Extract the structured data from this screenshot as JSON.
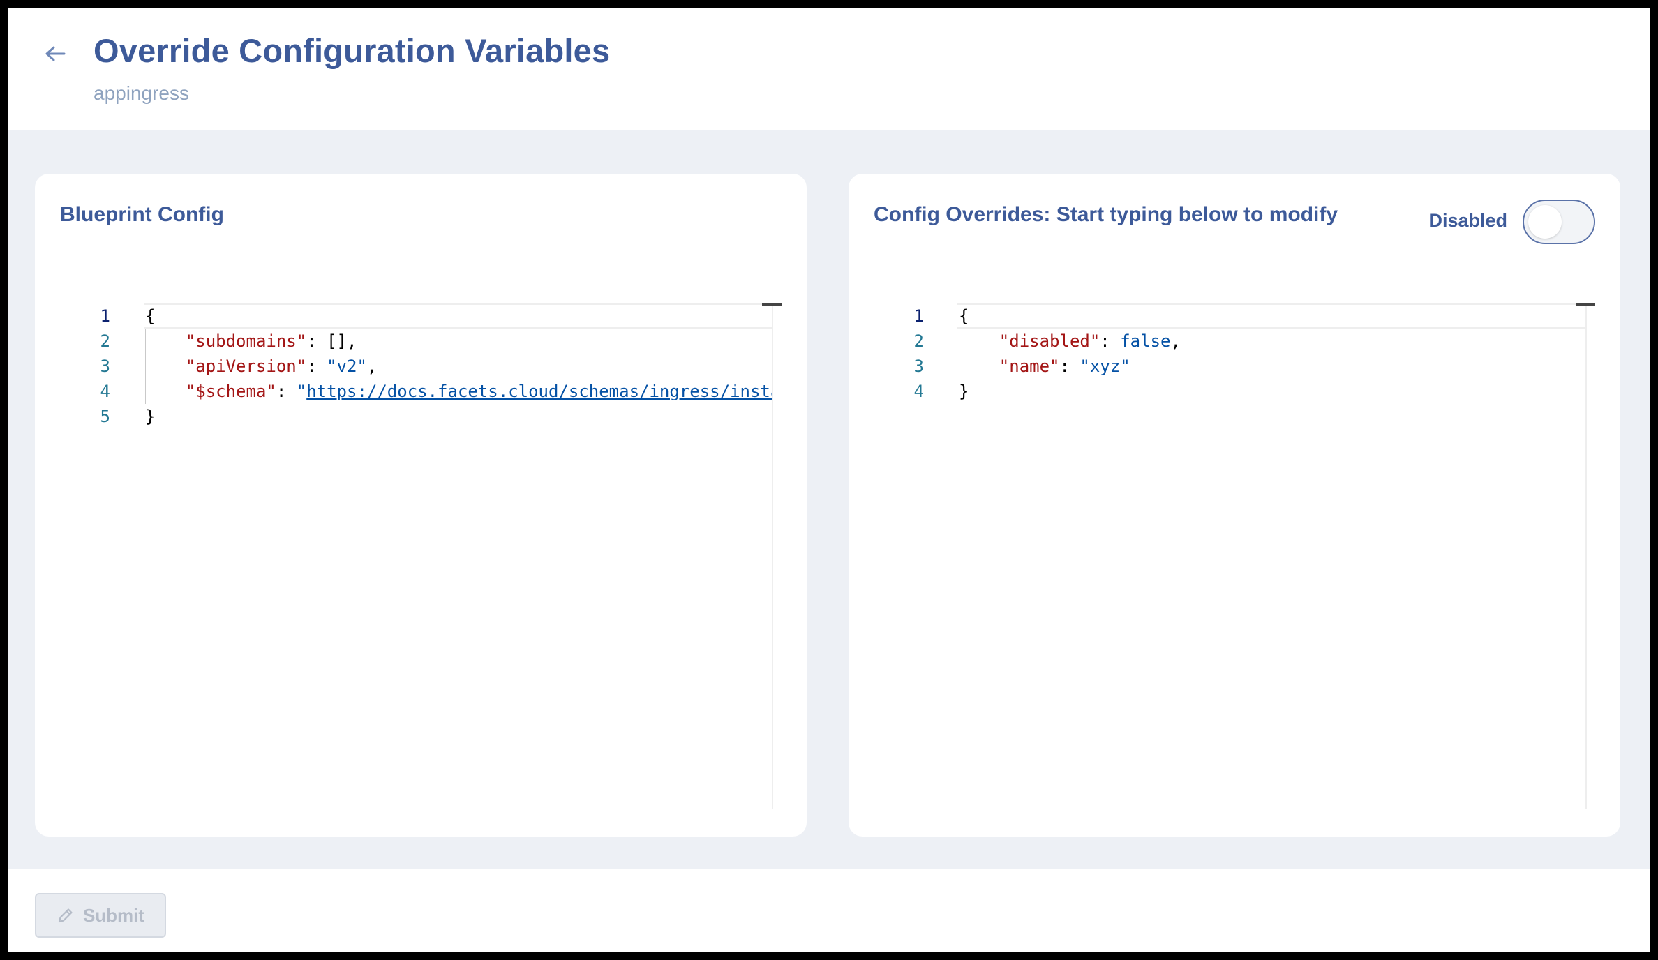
{
  "header": {
    "back_icon": "arrow-left-icon",
    "title": "Override Configuration Variables",
    "subtitle": "appingress"
  },
  "blueprint": {
    "title": "Blueprint Config",
    "line_numbers": [
      "1",
      "2",
      "3",
      "4",
      "5"
    ],
    "lines": [
      {
        "open": "{"
      },
      {
        "key": "\"subdomains\"",
        "sep": ": ",
        "value": "[]",
        "trail": ","
      },
      {
        "key": "\"apiVersion\"",
        "sep": ": ",
        "str": "\"v2\"",
        "trail": ","
      },
      {
        "key": "\"$schema\"",
        "sep": ": ",
        "quote": "\"",
        "link": "https://docs.facets.cloud/schemas/ingress/instance.schema.json"
      },
      {
        "close": "}"
      }
    ]
  },
  "overrides": {
    "title": "Config Overrides: Start typing below to modify",
    "toggle_label": "Disabled",
    "toggle_on": false,
    "line_numbers": [
      "1",
      "2",
      "3",
      "4"
    ],
    "lines": [
      {
        "open": "{"
      },
      {
        "key": "\"disabled\"",
        "sep": ": ",
        "bool": "false",
        "trail": ","
      },
      {
        "key": "\"name\"",
        "sep": ": ",
        "str": "\"xyz\""
      },
      {
        "close": "}"
      }
    ]
  },
  "footer": {
    "submit_label": "Submit",
    "submit_icon": "pencil-icon",
    "submit_enabled": false
  },
  "colors": {
    "accent": "#3d5a99",
    "json_key": "#a31515",
    "json_value": "#0451a5"
  }
}
